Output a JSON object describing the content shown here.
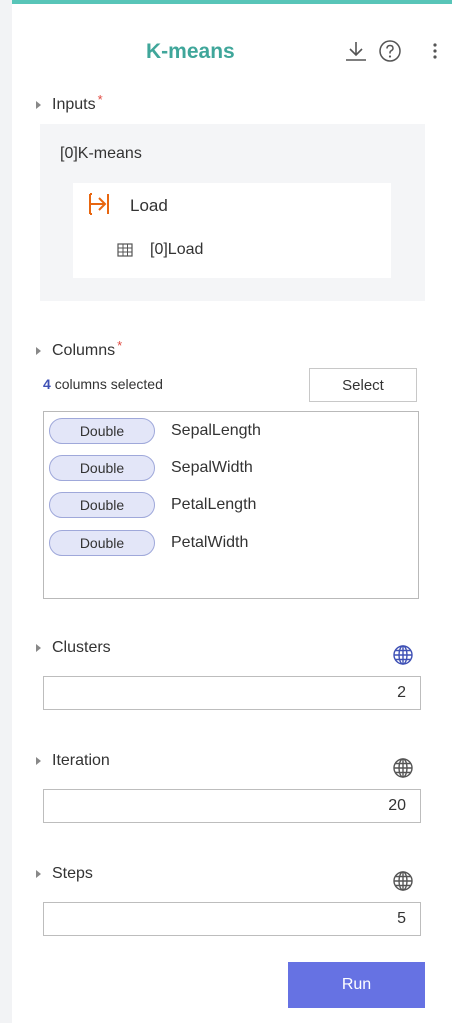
{
  "header": {
    "title": "K-means",
    "icons": [
      "download-icon",
      "help-icon",
      "more-vertical-icon"
    ]
  },
  "inputs": {
    "label": "Inputs",
    "required_mark": "*",
    "input_name": "[0]K-means",
    "source": {
      "label": "Load",
      "icon": "load-arrow-icon",
      "output": "[0]Load",
      "output_icon": "table-icon"
    }
  },
  "columns": {
    "label": "Columns",
    "required_mark": "*",
    "count": "4",
    "count_suffix": "columns selected",
    "select_label": "Select",
    "items": [
      {
        "type": "Double",
        "name": "SepalLength"
      },
      {
        "type": "Double",
        "name": "SepalWidth"
      },
      {
        "type": "Double",
        "name": "PetalLength"
      },
      {
        "type": "Double",
        "name": "PetalWidth"
      }
    ]
  },
  "clusters": {
    "label": "Clusters",
    "value": "2",
    "globe_color": "#3f51b5"
  },
  "iteration": {
    "label": "Iteration",
    "value": "20",
    "globe_color": "#555555"
  },
  "steps": {
    "label": "Steps",
    "value": "5",
    "globe_color": "#555555"
  },
  "run_label": "Run",
  "colors": {
    "accent": "#58c5b8",
    "title": "#3fa69a",
    "required": "#e0483f",
    "primary": "#6672e3",
    "load_icon": "#e8660f"
  }
}
